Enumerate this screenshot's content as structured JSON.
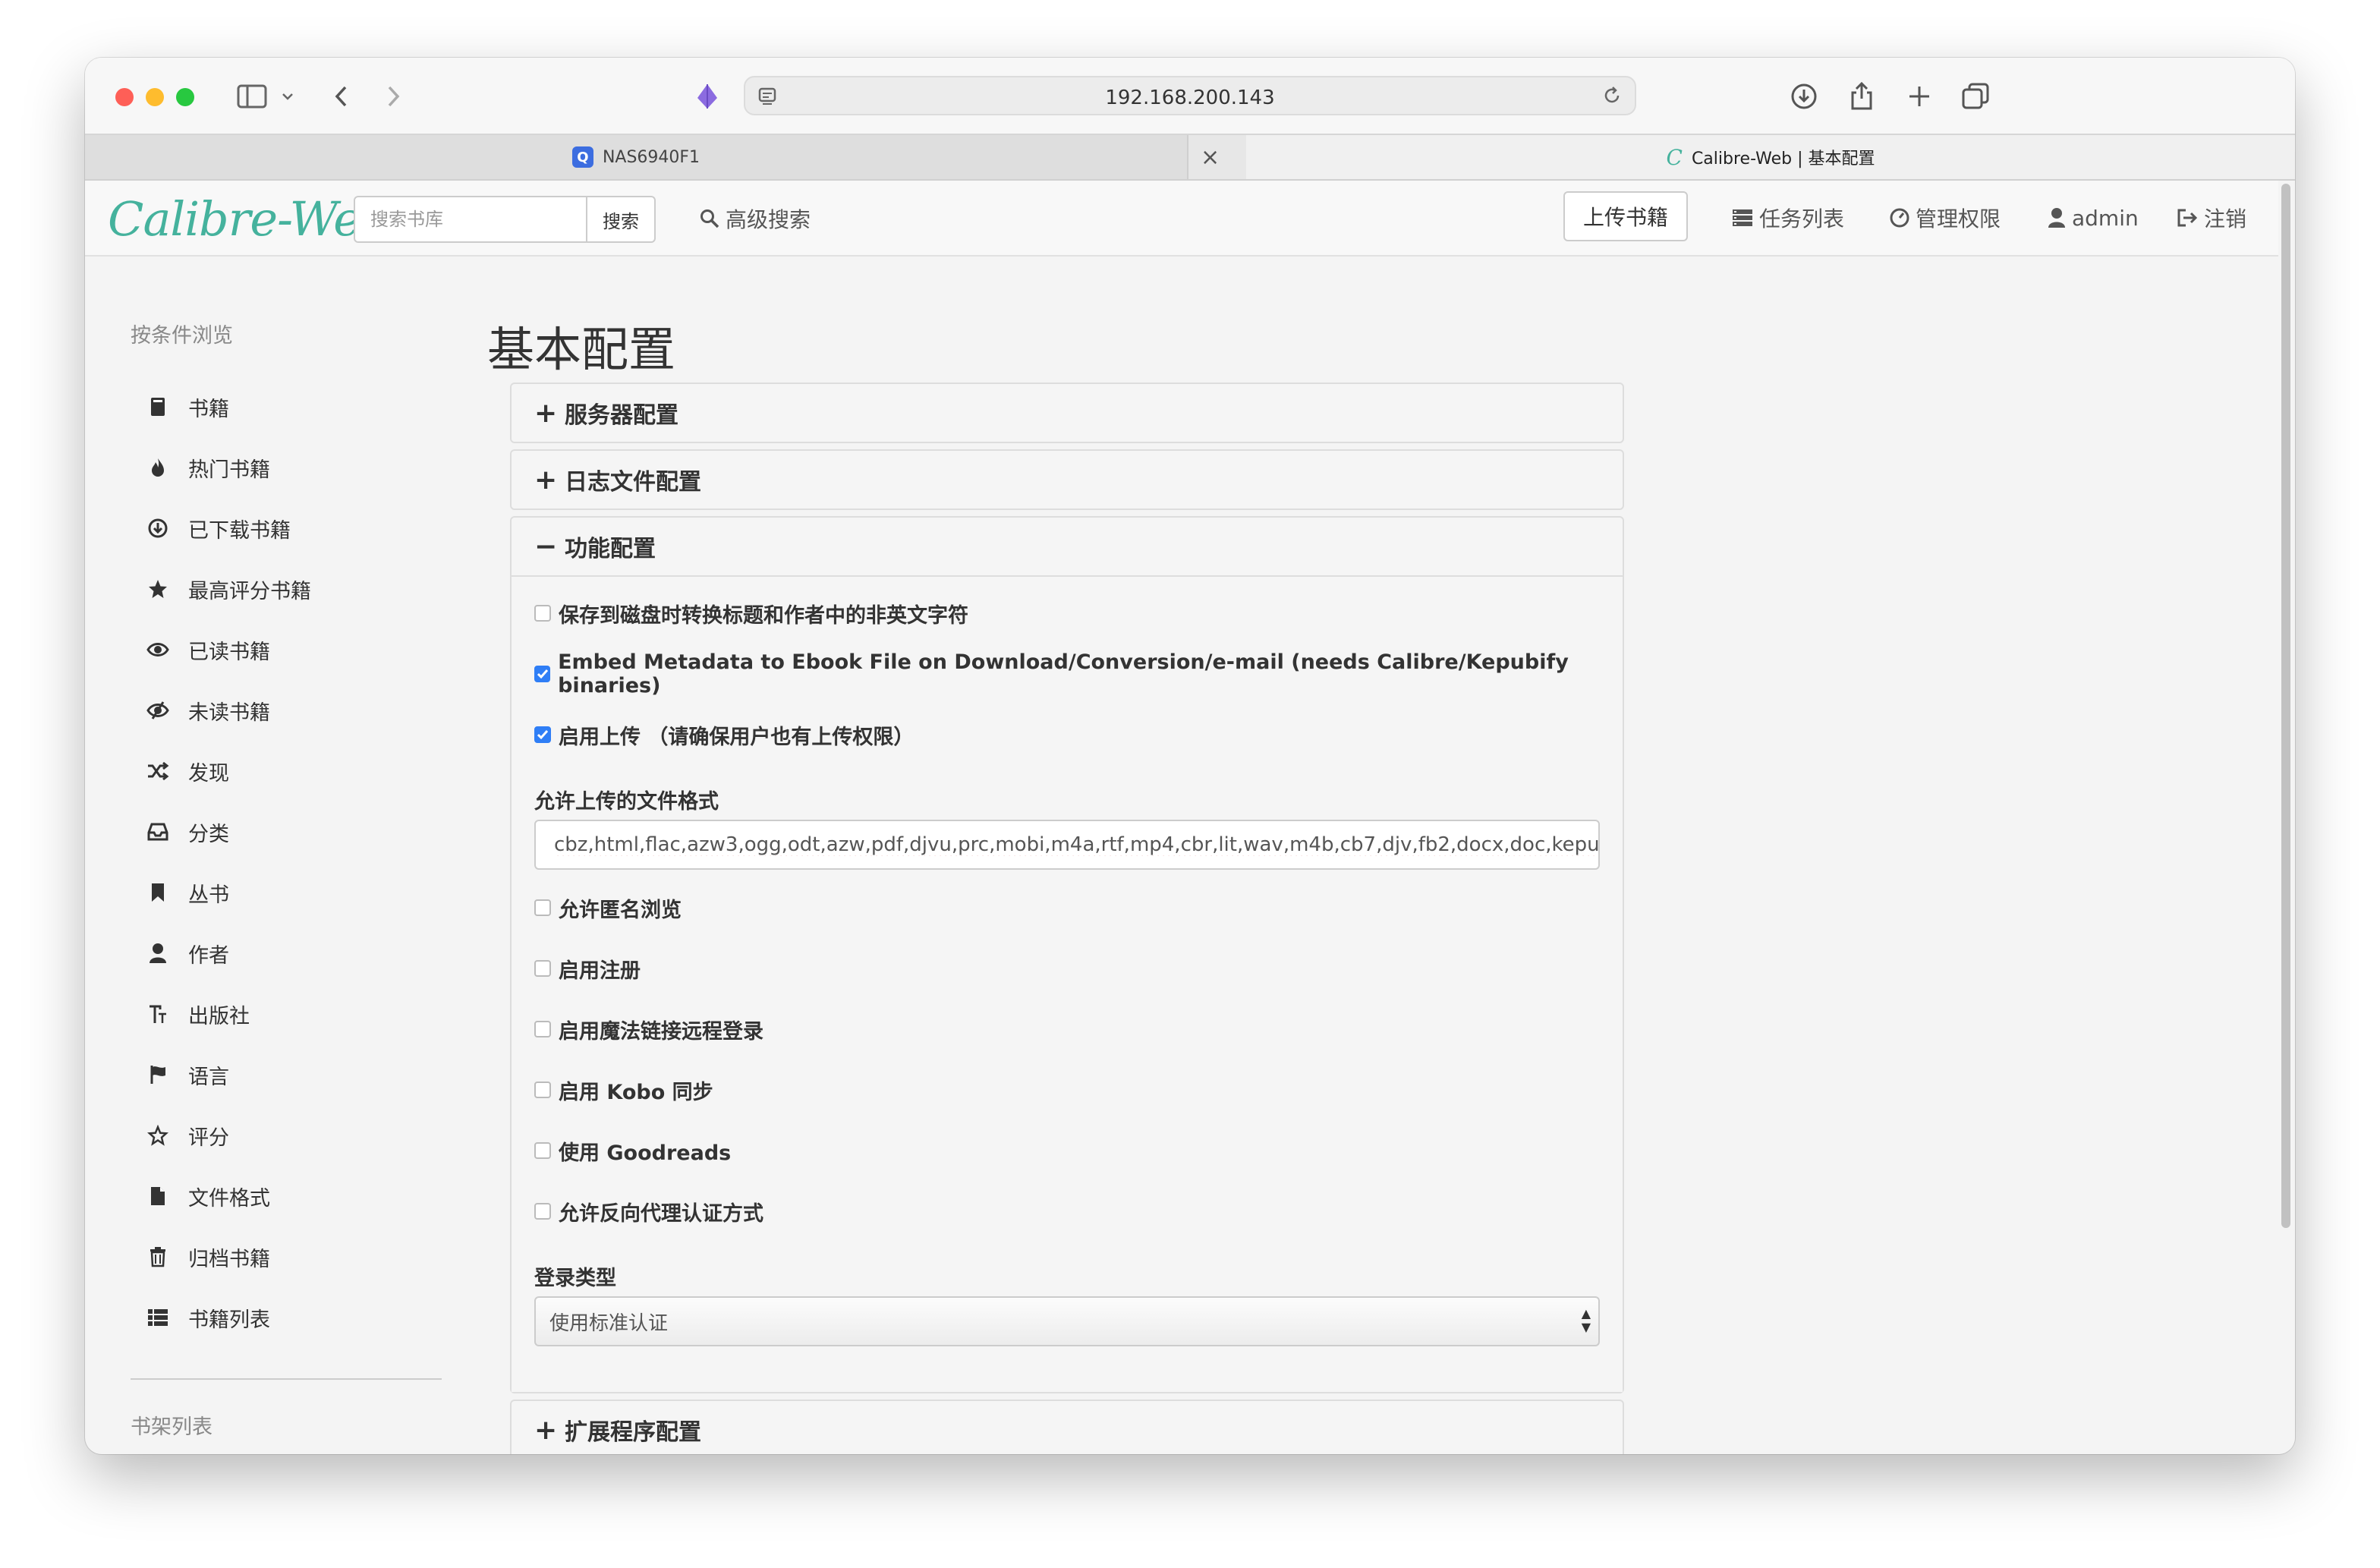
{
  "browser": {
    "url": "192.168.200.143",
    "tabs": [
      {
        "label": "NAS6940F1",
        "active": false
      },
      {
        "label": "Calibre-Web | 基本配置",
        "active": true
      }
    ],
    "tab_close": "×"
  },
  "navbar": {
    "logo": "Calibre-Web",
    "search_placeholder": "搜索书库",
    "search_button": "搜索",
    "advanced_search": "高级搜索",
    "upload": "上传书籍",
    "tasks": "任务列表",
    "admin_rights": "管理权限",
    "user": "admin",
    "logout": "注销"
  },
  "sidebar": {
    "heading": "按条件浏览",
    "items": [
      {
        "label": "书籍",
        "icon": "book-icon"
      },
      {
        "label": "热门书籍",
        "icon": "fire-icon"
      },
      {
        "label": "已下载书籍",
        "icon": "download-circle-icon"
      },
      {
        "label": "最高评分书籍",
        "icon": "star-icon"
      },
      {
        "label": "已读书籍",
        "icon": "eye-icon"
      },
      {
        "label": "未读书籍",
        "icon": "eye-slash-icon"
      },
      {
        "label": "发现",
        "icon": "shuffle-icon"
      },
      {
        "label": "分类",
        "icon": "inbox-icon"
      },
      {
        "label": "丛书",
        "icon": "bookmark-icon"
      },
      {
        "label": "作者",
        "icon": "user-icon"
      },
      {
        "label": "出版社",
        "icon": "text-size-icon"
      },
      {
        "label": "语言",
        "icon": "flag-icon"
      },
      {
        "label": "评分",
        "icon": "star-outline-icon"
      },
      {
        "label": "文件格式",
        "icon": "file-icon"
      },
      {
        "label": "归档书籍",
        "icon": "trash-icon"
      },
      {
        "label": "书籍列表",
        "icon": "list-icon"
      }
    ],
    "shelves_heading": "书架列表"
  },
  "main": {
    "title": "基本配置",
    "panels": {
      "server": {
        "sign": "+",
        "label": "服务器配置"
      },
      "logfile": {
        "sign": "+",
        "label": "日志文件配置"
      },
      "feature": {
        "sign": "−",
        "label": "功能配置"
      },
      "external": {
        "sign": "+",
        "label": "扩展程序配置"
      }
    },
    "feature": {
      "checks": [
        {
          "label": "保存到磁盘时转换标题和作者中的非英文字符",
          "checked": false
        },
        {
          "label": "Embed Metadata to Ebook File on Download/Conversion/e-mail (needs Calibre/Kepubify binaries)",
          "checked": true
        },
        {
          "label": "启用上传 （请确保用户也有上传权限）",
          "checked": true
        },
        {
          "label": "允许匿名浏览",
          "checked": false
        },
        {
          "label": "启用注册",
          "checked": false
        },
        {
          "label": "启用魔法链接远程登录",
          "checked": false
        },
        {
          "label": "启用 Kobo 同步",
          "checked": false
        },
        {
          "label": "使用 Goodreads",
          "checked": false
        },
        {
          "label": "允许反向代理认证方式",
          "checked": false
        }
      ],
      "upload_formats_label": "允许上传的文件格式",
      "upload_formats_value": "cbz,html,flac,azw3,ogg,odt,azw,pdf,djvu,prc,mobi,m4a,rtf,mp4,cbr,lit,wav,m4b,cb7,djv,fb2,docx,doc,kepub,r",
      "login_type_label": "登录类型",
      "login_type_value": "使用标准认证"
    }
  },
  "colors": {
    "accent": "#45b29d",
    "checkbox_on": "#2f7ef6"
  }
}
